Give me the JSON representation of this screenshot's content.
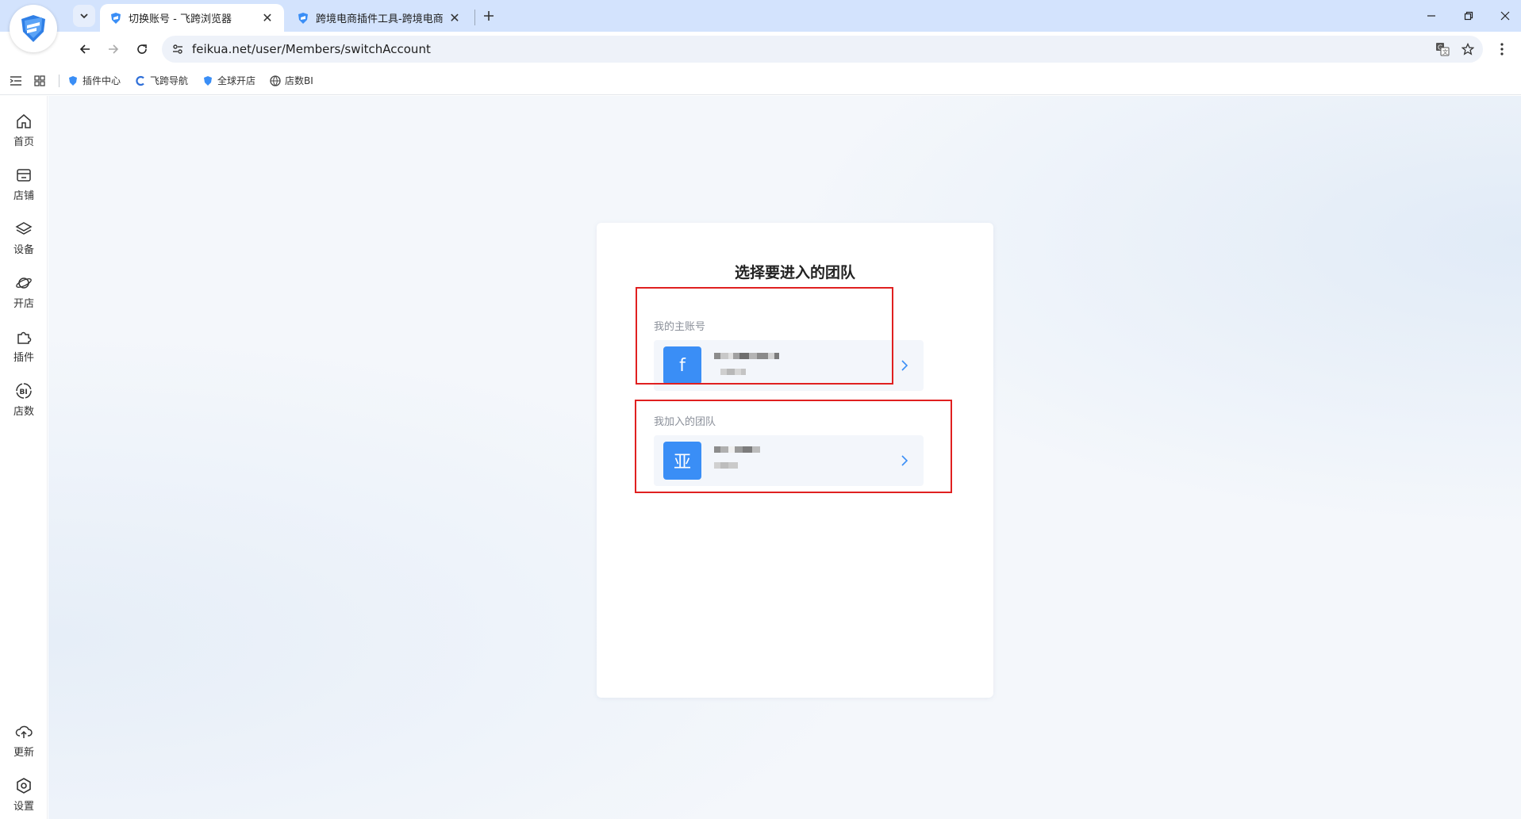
{
  "browser": {
    "tabs": [
      {
        "title": "切换账号 - 飞跨浏览器",
        "active": true
      },
      {
        "title": "跨境电商插件工具-跨境电商翻",
        "active": false
      }
    ],
    "url": "feikua.net/user/Members/switchAccount"
  },
  "bookmarks": [
    {
      "label": "插件中心",
      "icon": "feikua-shield-icon"
    },
    {
      "label": "飞跨导航",
      "icon": "c-logo-icon"
    },
    {
      "label": "全球开店",
      "icon": "feikua-shield-icon"
    },
    {
      "label": "店数BI",
      "icon": "globe-icon"
    }
  ],
  "sidebar": {
    "top": [
      {
        "label": "首页",
        "icon": "home-icon"
      },
      {
        "label": "店铺",
        "icon": "store-icon"
      },
      {
        "label": "设备",
        "icon": "layers-icon"
      },
      {
        "label": "开店",
        "icon": "planet-icon"
      },
      {
        "label": "插件",
        "icon": "puzzle-icon"
      },
      {
        "label": "店数",
        "icon": "bi-icon"
      }
    ],
    "bottom": [
      {
        "label": "更新",
        "icon": "cloud-upload-icon"
      },
      {
        "label": "设置",
        "icon": "hexagon-gear-icon"
      }
    ]
  },
  "card": {
    "title": "选择要进入的团队",
    "main_account": {
      "section_label": "我的主账号",
      "avatar_letter": "f"
    },
    "joined_team": {
      "section_label": "我加入的团队",
      "avatar_letter": "亚"
    }
  },
  "colors": {
    "accent": "#3a8ef6",
    "highlight_border": "#e02020",
    "titlebar": "#d3e3fd"
  }
}
